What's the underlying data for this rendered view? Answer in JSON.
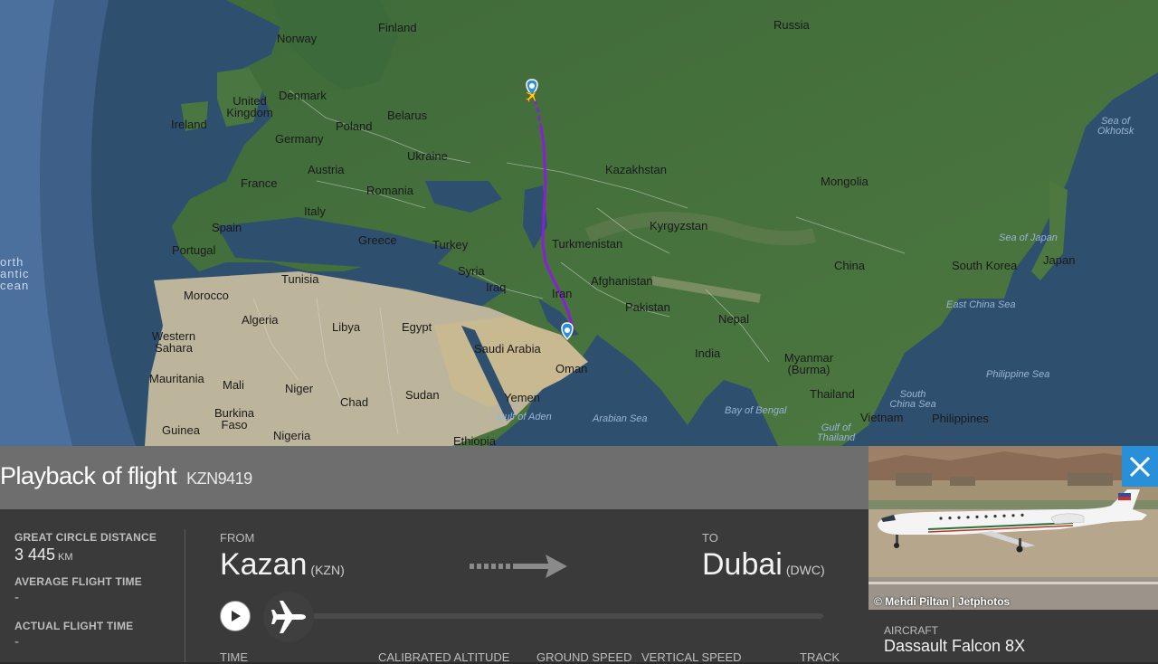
{
  "map": {
    "countries": [
      "Russia",
      "Finland",
      "Norway",
      "Denmark",
      "United Kingdom",
      "Ireland",
      "Poland",
      "Belarus",
      "Germany",
      "Ukraine",
      "Kazakhstan",
      "Mongolia",
      "Austria",
      "France",
      "Romania",
      "Italy",
      "Kyrgyzstan",
      "Spain",
      "Portugal",
      "Greece",
      "Turkey",
      "Turkmenistan",
      "China",
      "South Korea",
      "Japan",
      "Tunisia",
      "Syria",
      "Iraq",
      "Afghanistan",
      "Iran",
      "Morocco",
      "Algeria",
      "Libya",
      "Egypt",
      "Pakistan",
      "Nepal",
      "Western Sahara",
      "Saudi Arabia",
      "India",
      "Myanmar (Burma)",
      "Oman",
      "Mauritania",
      "Mali",
      "Niger",
      "Chad",
      "Sudan",
      "Thailand",
      "Yemen",
      "Vietnam",
      "Philippines",
      "Burkina Faso",
      "Guinea",
      "Nigeria",
      "Ethiopia"
    ],
    "seas": [
      "Sea of Okhotsk",
      "Sea of Japan",
      "East China Sea",
      "Philippine Sea",
      "South China Sea",
      "Gulf of Aden",
      "Arabian Sea",
      "Bay of Bengal",
      "Gulf of Thailand"
    ],
    "ocean": "orth antic cean"
  },
  "panel": {
    "title": "Playback of flight",
    "flight_number": "KZN9419",
    "stats": {
      "distance_label": "GREAT CIRCLE DISTANCE",
      "distance_value": "3 445",
      "distance_unit": "KM",
      "avg_time_label": "AVERAGE FLIGHT TIME",
      "avg_time_value": "-",
      "actual_time_label": "ACTUAL FLIGHT TIME",
      "actual_time_value": "-"
    },
    "from": {
      "label": "FROM",
      "city": "Kazan",
      "code": "(KZN)"
    },
    "to": {
      "label": "TO",
      "city": "Dubai",
      "code": "(DWC)"
    },
    "columns": [
      "TIME",
      "CALIBRATED ALTITUDE",
      "GROUND SPEED",
      "VERTICAL SPEED",
      "TRACK"
    ]
  },
  "photo": {
    "credit": "© Mehdi Piltan | Jetphotos"
  },
  "aircraft": {
    "label": "AIRCRAFT",
    "value": "Dassault Falcon 8X"
  },
  "colors": {
    "route": "#8a1fd6",
    "accent": "#2a8fd9",
    "marker": "#2a8fd9"
  }
}
